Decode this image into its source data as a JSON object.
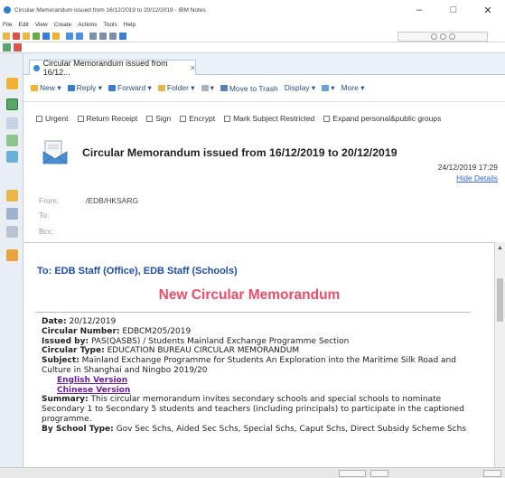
{
  "window": {
    "title": "Circular Memorandum issued from 16/12/2019 to 20/12/2019 - IBM Notes",
    "controls": [
      "–",
      "□",
      "✕"
    ]
  },
  "menu": [
    "File",
    "Edit",
    "View",
    "Create",
    "Actions",
    "Tools",
    "Help"
  ],
  "tab": {
    "label": "Circular Memorandum issued from 16/12...",
    "close": "×"
  },
  "actions": [
    {
      "label": "New ▾",
      "icon": "star-icon",
      "color": "#f2b233"
    },
    {
      "label": "Reply ▾",
      "icon": "reply-icon",
      "color": "#3a7bd5"
    },
    {
      "label": "Forward ▾",
      "icon": "forward-icon",
      "color": "#3a7bd5"
    },
    {
      "label": "Folder ▾",
      "icon": "folder-icon",
      "color": "#e8b64a"
    },
    {
      "label": "▾",
      "icon": "flag-icon",
      "color": "#a9b4c2"
    },
    {
      "label": "Move to Trash",
      "icon": "trash-icon",
      "color": "#5a7fb0"
    },
    {
      "label": "Display ▾",
      "icon": "",
      "color": ""
    },
    {
      "label": "▾",
      "icon": "search-icon",
      "color": "#6aa0d8"
    },
    {
      "label": "More ▾",
      "icon": "",
      "color": ""
    }
  ],
  "options": [
    "Urgent",
    "Return Receipt",
    "Sign",
    "Encrypt",
    "Mark Subject Restricted",
    "Expand personal&public groups"
  ],
  "subject": "Circular Memorandum issued from 16/12/2019 to 20/12/2019",
  "datetime": "24/12/2019 17:29",
  "hide_details": "Hide Details",
  "headers": {
    "from_label": "From:",
    "from_value": "/EDB/HKSARG",
    "to_label": "To:",
    "bcc_label": "Bcc:"
  },
  "body": {
    "to_line": "To: EDB Staff (Office), EDB Staff (Schools)",
    "heading": "New Circular Memorandum",
    "date_label": "Date:",
    "date_value": "20/12/2019",
    "number_label": "Circular Number:",
    "number_value": "EDBCM205/2019",
    "issued_label": "Issued by:",
    "issued_value": "PAS(QASBS) / Students Mainland Exchange Programme Section",
    "type_label": "Circular Type:",
    "type_value": "EDUCATION BUREAU CIRCULAR MEMORANDUM",
    "subject_label": "Subject:",
    "subject_value": "Mainland Exchange Programme for Students An Exploration into the Maritime Silk Road and Culture in Shanghai and Ningbo 2019/20",
    "english_link": "English Version",
    "chinese_link": "Chinese Version",
    "summary_label": "Summary:",
    "summary_value": "This circular memorandum invites secondary schools and special schools to nominate Secondary 1 to Secondary 5 students and teachers (including principals) to participate in the captioned programme.",
    "school_type_label": "By School Type:",
    "school_type_value": "Gov Sec Schs, Aided Sec Schs, Special Schs, Caput Schs, Direct Subsidy Scheme Schs"
  }
}
